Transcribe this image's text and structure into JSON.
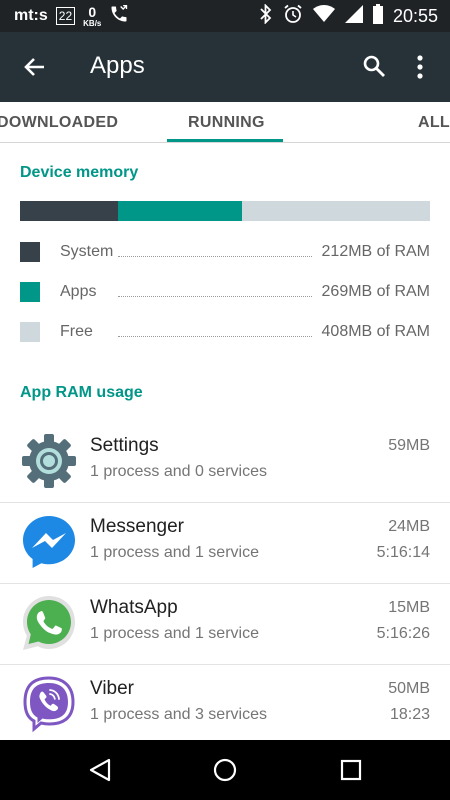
{
  "status_bar": {
    "carrier": "mt:s",
    "badge": "22",
    "net_speed": "0",
    "net_unit": "KB/s",
    "time": "20:55",
    "icons": [
      "missed-call-icon",
      "bluetooth-icon",
      "alarm-icon",
      "wifi-icon",
      "cell-signal-icon",
      "battery-icon"
    ]
  },
  "app_bar": {
    "title": "Apps",
    "icons": [
      "back-arrow-icon",
      "search-icon",
      "more-vert-icon"
    ]
  },
  "tabs": [
    {
      "label": "DOWNLOADED",
      "selected": false
    },
    {
      "label": "RUNNING",
      "selected": true
    },
    {
      "label": "ALL",
      "selected": false
    }
  ],
  "device_memory": {
    "heading": "Device memory",
    "usage": [
      {
        "name": "System",
        "value": "212MB of RAM",
        "mb": 212,
        "color": "#37414a"
      },
      {
        "name": "Apps",
        "value": "269MB of RAM",
        "mb": 269,
        "color": "#009688"
      },
      {
        "name": "Free",
        "value": "408MB of RAM",
        "mb": 408,
        "color": "#cfd8dc"
      }
    ]
  },
  "app_ram": {
    "heading": "App RAM usage",
    "apps": [
      {
        "name": "Settings",
        "detail": "1 process and 0 services",
        "memory": "59MB",
        "time": "",
        "icon": "settings-gear-icon"
      },
      {
        "name": "Messenger",
        "detail": "1 process and 1 service",
        "memory": "24MB",
        "time": "5:16:14",
        "icon": "messenger-icon"
      },
      {
        "name": "WhatsApp",
        "detail": "1 process and 1 service",
        "memory": "15MB",
        "time": "5:16:26",
        "icon": "whatsapp-icon"
      },
      {
        "name": "Viber",
        "detail": "1 process and 3 services",
        "memory": "50MB",
        "time": "18:23",
        "icon": "viber-icon"
      }
    ]
  },
  "nav_bar": {
    "icons": [
      "nav-back-icon",
      "nav-home-icon",
      "nav-recents-icon"
    ]
  }
}
